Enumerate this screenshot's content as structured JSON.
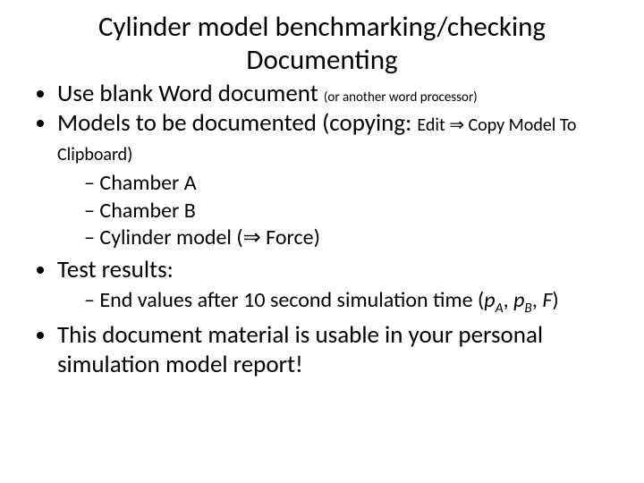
{
  "title_line1": "Cylinder model benchmarking/checking",
  "title_line2": "Documenting",
  "b1_main": "Use blank Word document ",
  "b1_small": "(or another word processor)",
  "b2_main": "Models to be documented (copying: ",
  "b2_small_a": "Edit ",
  "b2_small_b": " Copy Model To Clipboard)",
  "arrow": "⇒",
  "s1": "Chamber A",
  "s2": "Chamber B",
  "s3a": "Cylinder model (",
  "s3b": " Force)",
  "b3": "Test results:",
  "s4a": "End values after 10 second simulation time (",
  "s4_pA_p": "p",
  "s4_pA_sub": "A",
  "s4_c1": ", ",
  "s4_pB_p": "p",
  "s4_pB_sub": "B",
  "s4_c2": ", ",
  "s4_F": "F",
  "s4_end": ")",
  "b4": "This document material is usable in your personal simulation model report!"
}
